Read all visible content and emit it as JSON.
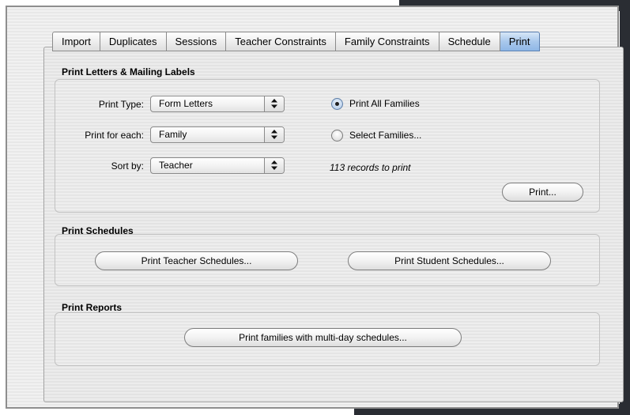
{
  "tabs": [
    "Import",
    "Duplicates",
    "Sessions",
    "Teacher Constraints",
    "Family Constraints",
    "Schedule",
    "Print"
  ],
  "active_tab": "Print",
  "letters": {
    "title": "Print Letters & Mailing Labels",
    "print_type_label": "Print Type:",
    "print_type_value": "Form Letters",
    "print_for_each_label": "Print for each:",
    "print_for_each_value": "Family",
    "sort_by_label": "Sort by:",
    "sort_by_value": "Teacher",
    "radio_all": "Print All Families",
    "radio_select": "Select Families...",
    "records": "113 records to print",
    "print_button": "Print..."
  },
  "schedules": {
    "title": "Print Schedules",
    "teacher_button": "Print Teacher Schedules...",
    "student_button": "Print Student Schedules..."
  },
  "reports": {
    "title": "Print Reports",
    "multi_day_button": "Print families with multi-day schedules..."
  }
}
